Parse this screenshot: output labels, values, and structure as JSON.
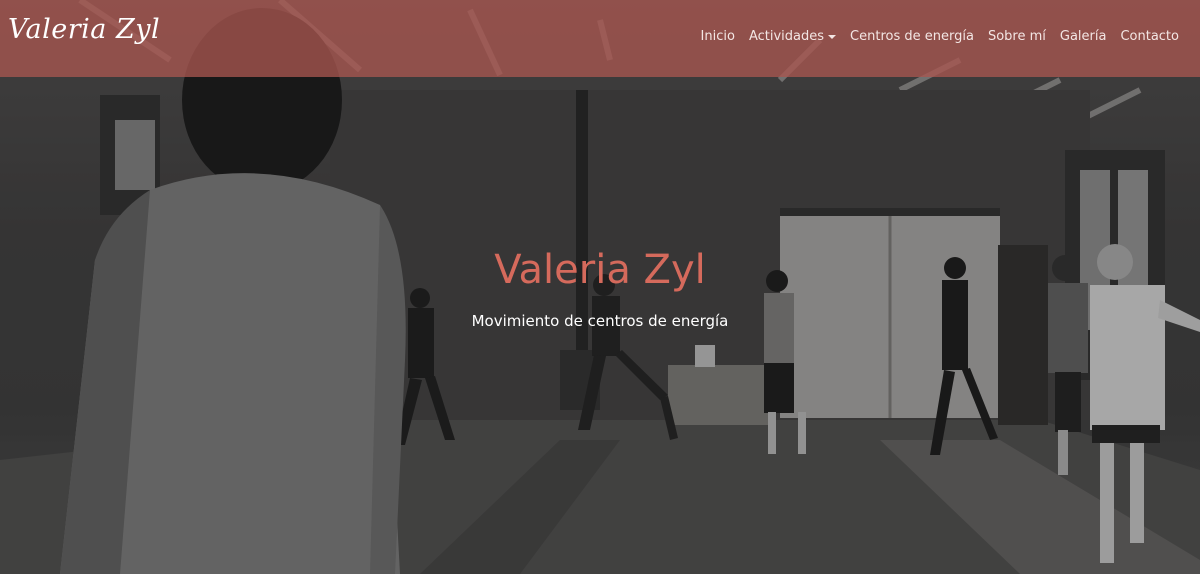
{
  "brand": {
    "name": "Valeria Zyl"
  },
  "nav": {
    "items": [
      {
        "label": "Inicio",
        "dropdown": false
      },
      {
        "label": "Actividades",
        "dropdown": true,
        "icon": "caret-down-icon"
      },
      {
        "label": "Centros de energía",
        "dropdown": false
      },
      {
        "label": "Sobre mí",
        "dropdown": false
      },
      {
        "label": "Galería",
        "dropdown": false
      },
      {
        "label": "Contacto",
        "dropdown": false
      }
    ]
  },
  "hero": {
    "title": "Valeria Zyl",
    "subtitle": "Movimiento de centros de energía"
  },
  "colors": {
    "navbar": "#a85650",
    "title": "#d56a5c",
    "text": "#ffffff"
  }
}
